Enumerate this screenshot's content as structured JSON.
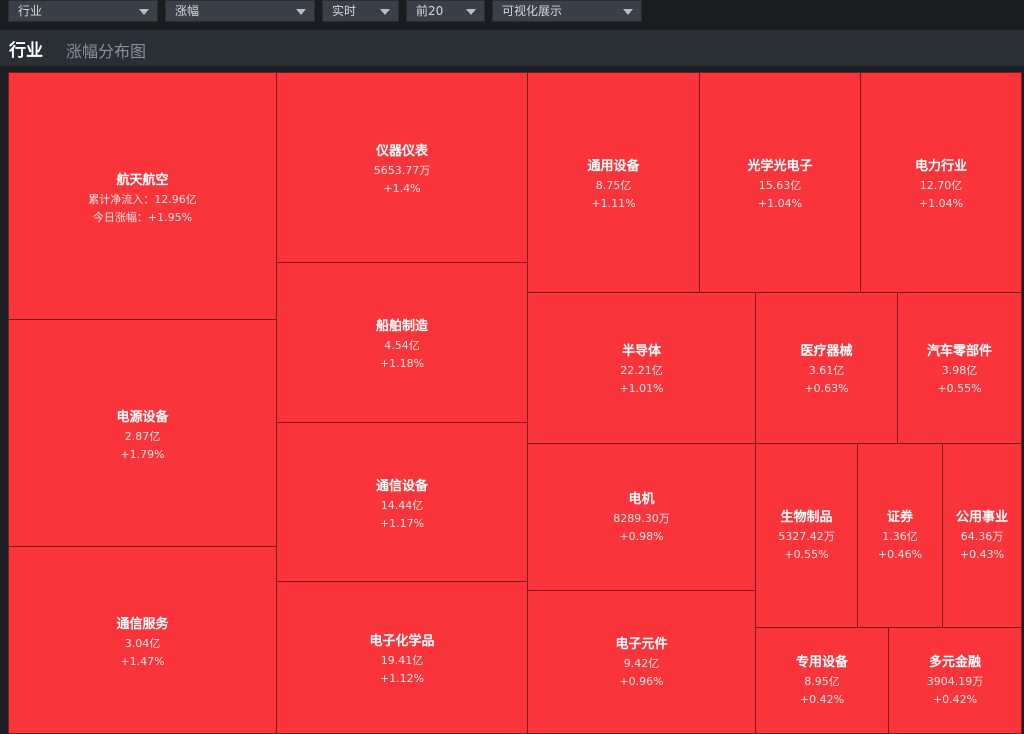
{
  "toolbar": {
    "selects": [
      {
        "value": "行业"
      },
      {
        "value": "涨幅"
      },
      {
        "value": "实时"
      },
      {
        "value": "前20"
      },
      {
        "value": "可视化展示"
      }
    ]
  },
  "header": {
    "title": "行业",
    "subtitle": "涨幅分布图"
  },
  "colors": {
    "tile_fill": "#f9353b",
    "tile_border": "#7a1a1d",
    "background": "#1b1e23"
  },
  "tiles": [
    {
      "name": "航天航空",
      "line1": "累计净流入：12.96亿",
      "line2": "今日涨幅：+1.95%"
    },
    {
      "name": "电源设备",
      "line1": "2.87亿",
      "line2": "+1.79%"
    },
    {
      "name": "通信服务",
      "line1": "3.04亿",
      "line2": "+1.47%"
    },
    {
      "name": "仪器仪表",
      "line1": "5653.77万",
      "line2": "+1.4%"
    },
    {
      "name": "船舶制造",
      "line1": "4.54亿",
      "line2": "+1.18%"
    },
    {
      "name": "通信设备",
      "line1": "14.44亿",
      "line2": "+1.17%"
    },
    {
      "name": "电子化学品",
      "line1": "19.41亿",
      "line2": "+1.12%"
    },
    {
      "name": "通用设备",
      "line1": "8.75亿",
      "line2": "+1.11%"
    },
    {
      "name": "光学光电子",
      "line1": "15.63亿",
      "line2": "+1.04%"
    },
    {
      "name": "电力行业",
      "line1": "12.70亿",
      "line2": "+1.04%"
    },
    {
      "name": "半导体",
      "line1": "22.21亿",
      "line2": "+1.01%"
    },
    {
      "name": "医疗器械",
      "line1": "3.61亿",
      "line2": "+0.63%"
    },
    {
      "name": "汽车零部件",
      "line1": "3.98亿",
      "line2": "+0.55%"
    },
    {
      "name": "电机",
      "line1": "8289.30万",
      "line2": "+0.98%"
    },
    {
      "name": "生物制品",
      "line1": "5327.42万",
      "line2": "+0.55%"
    },
    {
      "name": "证券",
      "line1": "1.36亿",
      "line2": "+0.46%"
    },
    {
      "name": "公用事业",
      "line1": "64.36万",
      "line2": "+0.43%"
    },
    {
      "name": "电子元件",
      "line1": "9.42亿",
      "line2": "+0.96%"
    },
    {
      "name": "专用设备",
      "line1": "8.95亿",
      "line2": "+0.42%"
    },
    {
      "name": "多元金融",
      "line1": "3904.19万",
      "line2": "+0.42%"
    }
  ]
}
